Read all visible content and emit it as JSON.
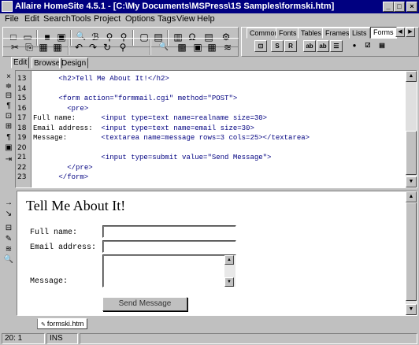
{
  "window": {
    "title": "Allaire HomeSite 4.5.1 - [C:\\My Documents\\MSPress\\1S Samples\\formski.htm]",
    "buttons": [
      "_",
      "□",
      "×"
    ]
  },
  "menu": [
    "File",
    "Edit",
    "Search",
    "Tools",
    "Project",
    "Options",
    "Tags",
    "View",
    "Help"
  ],
  "toolbar1": {
    "icons": [
      "new-file-icon",
      "open-folder-icon",
      "save-icon",
      "save-all-icon",
      "search-icon",
      "replace-icon",
      "find-icon",
      "find-next-icon",
      "browse-icon",
      "outline-icon",
      "tag-inspector-icon",
      "special-chars-icon",
      "validate-icon",
      "spell-check-icon"
    ],
    "glyphs": [
      "□",
      "▭",
      "■",
      "▣",
      "🔍",
      "ℬ",
      "⚲",
      "⚲",
      "▢",
      "▤",
      "▥",
      "Ω",
      "▤",
      "⚙"
    ]
  },
  "toolbar2": {
    "icons": [
      "cut-icon",
      "copy-icon",
      "paste-icon",
      "paste-special-icon",
      "undo-icon",
      "redo-icon",
      "refresh-icon",
      "tag-chooser-icon",
      "zoom-icon",
      "image-icon",
      "settings-icon",
      "color-icon",
      "snippets-icon"
    ],
    "glyphs": [
      "✂",
      "⎘",
      "▦",
      "▦",
      "↶",
      "↷",
      "↻",
      "⚲",
      "🔍",
      "▩",
      "▣",
      "▦",
      "≋"
    ]
  },
  "quickbar": {
    "tabs": [
      "Common",
      "Fonts",
      "Tables",
      "Frames",
      "Lists",
      "Forms"
    ],
    "active": "Forms",
    "buttons": [
      "⊡",
      "S",
      "R",
      "ab",
      "ab",
      "☰",
      "●",
      "☑",
      "▤"
    ]
  },
  "editor_tabs": [
    "Edit",
    "Browse",
    "Design"
  ],
  "editor_tab_active": "Edit",
  "left_icons": [
    "×",
    "≑",
    "⊟",
    "¶",
    "⊡",
    "⊞",
    "¶",
    "▣",
    "⇥"
  ],
  "left_icons_lower": [
    "→",
    "↘",
    "⊟",
    "✎",
    "≋",
    "🔍"
  ],
  "line_numbers": [
    "13",
    "14",
    "15",
    "16",
    "17",
    "18",
    "19",
    "20",
    "21",
    "22",
    "23"
  ],
  "code_lines": [
    {
      "indent": "      ",
      "text": "<h2>Tell Me About It!</h2>",
      "mixed": false
    },
    {
      "indent": "",
      "text": "",
      "mixed": false
    },
    {
      "indent": "      ",
      "text": "<form action=\"formmail.cgi\" method=\"POST\">",
      "mixed": false
    },
    {
      "indent": "        ",
      "text": "<pre>",
      "mixed": false
    },
    {
      "indent": "",
      "plain": "Full name:      ",
      "text": "<input type=text name=realname size=30>",
      "mixed": true
    },
    {
      "indent": "",
      "plain": "Email address:  ",
      "text": "<input type=text name=email size=30>",
      "mixed": true
    },
    {
      "indent": "",
      "plain": "Message:        ",
      "text": "<textarea name=message rows=3 cols=25></textarea>",
      "mixed": true
    },
    {
      "indent": "",
      "text": "",
      "mixed": false
    },
    {
      "indent": "                ",
      "text": "<input type=submit value=\"Send Message\">",
      "mixed": false
    },
    {
      "indent": "        ",
      "text": "</pre>",
      "mixed": false
    },
    {
      "indent": "      ",
      "text": "</form>",
      "mixed": false
    }
  ],
  "preview": {
    "heading": "Tell Me About It!",
    "fields": [
      {
        "label": "Full name:",
        "value": ""
      },
      {
        "label": "Email address:",
        "value": ""
      }
    ],
    "message_label": "Message:",
    "message_value": "",
    "submit_label": "Send Message"
  },
  "document_tab": "formski.htm",
  "status": {
    "position": "20: 1",
    "mode": "INS",
    "extra": ""
  },
  "colors": {
    "titlebar": "#000080",
    "face": "#c0c0c0",
    "tag_text": "#000080"
  }
}
